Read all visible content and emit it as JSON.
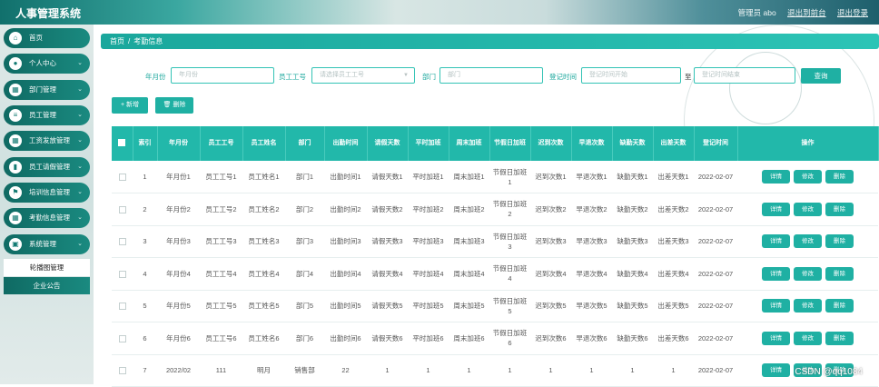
{
  "app": {
    "title": "人事管理系统"
  },
  "topbar": {
    "role_user": "管理员 abo",
    "back_link": "退出到前台",
    "logout_link": "退出登录"
  },
  "sidebar": {
    "items": [
      {
        "label": "首页",
        "icon": "home-icon",
        "glyph": "⌂",
        "has_chevron": false
      },
      {
        "label": "个人中心",
        "icon": "user-icon",
        "glyph": "●",
        "has_chevron": true
      },
      {
        "label": "部门管理",
        "icon": "grid-icon",
        "glyph": "▦",
        "has_chevron": true
      },
      {
        "label": "员工管理",
        "icon": "list-icon",
        "glyph": "≡",
        "has_chevron": true
      },
      {
        "label": "工资发放管理",
        "icon": "grid-icon",
        "glyph": "▦",
        "has_chevron": true
      },
      {
        "label": "员工请假管理",
        "icon": "chart-icon",
        "glyph": "▮",
        "has_chevron": true
      },
      {
        "label": "培训信息管理",
        "icon": "flag-icon",
        "glyph": "⚑",
        "has_chevron": true
      },
      {
        "label": "考勤信息管理",
        "icon": "grid-icon",
        "glyph": "▦",
        "has_chevron": true
      },
      {
        "label": "系统管理",
        "icon": "settings-icon",
        "glyph": "▣",
        "has_chevron": true,
        "expanded": true
      }
    ],
    "sub_items": [
      {
        "label": "轮播图管理",
        "active": true
      },
      {
        "label": "企业公告",
        "active": false
      }
    ]
  },
  "breadcrumb": {
    "home": "首页",
    "separator": "/",
    "current": "考勤信息"
  },
  "filters": {
    "month_label": "年月份",
    "month_placeholder": "年月份",
    "empno_label": "员工工号",
    "empno_placeholder": "请选择员工工号",
    "dept_label": "部门",
    "dept_placeholder": "部门",
    "regtime_label": "登记时间",
    "regtime_start_placeholder": "登记时间开始",
    "regtime_to": "至",
    "regtime_end_placeholder": "登记时间结束",
    "query_button": "查询"
  },
  "actions": {
    "add_button": "+ 新增",
    "delete_button": "删除"
  },
  "table": {
    "headers": [
      "",
      "索引",
      "年月份",
      "员工工号",
      "员工姓名",
      "部门",
      "出勤时间",
      "请假天数",
      "平时加班",
      "周末加班",
      "节假日加班",
      "迟到次数",
      "早退次数",
      "缺勤天数",
      "出差天数",
      "登记时间",
      "操作"
    ],
    "row_buttons": {
      "detail": "详情",
      "edit": "修改",
      "delete": "删除"
    },
    "rows": [
      [
        "1",
        "年月份1",
        "员工工号1",
        "员工姓名1",
        "部门1",
        "出勤时间1",
        "请假天数1",
        "平时加班1",
        "周末加班1",
        "节假日加班1",
        "迟到次数1",
        "早退次数1",
        "缺勤天数1",
        "出差天数1",
        "2022-02-07"
      ],
      [
        "2",
        "年月份2",
        "员工工号2",
        "员工姓名2",
        "部门2",
        "出勤时间2",
        "请假天数2",
        "平时加班2",
        "周末加班2",
        "节假日加班2",
        "迟到次数2",
        "早退次数2",
        "缺勤天数2",
        "出差天数2",
        "2022-02-07"
      ],
      [
        "3",
        "年月份3",
        "员工工号3",
        "员工姓名3",
        "部门3",
        "出勤时间3",
        "请假天数3",
        "平时加班3",
        "周末加班3",
        "节假日加班3",
        "迟到次数3",
        "早退次数3",
        "缺勤天数3",
        "出差天数3",
        "2022-02-07"
      ],
      [
        "4",
        "年月份4",
        "员工工号4",
        "员工姓名4",
        "部门4",
        "出勤时间4",
        "请假天数4",
        "平时加班4",
        "周末加班4",
        "节假日加班4",
        "迟到次数4",
        "早退次数4",
        "缺勤天数4",
        "出差天数4",
        "2022-02-07"
      ],
      [
        "5",
        "年月份5",
        "员工工号5",
        "员工姓名5",
        "部门5",
        "出勤时间5",
        "请假天数5",
        "平时加班5",
        "周末加班5",
        "节假日加班5",
        "迟到次数5",
        "早退次数5",
        "缺勤天数5",
        "出差天数5",
        "2022-02-07"
      ],
      [
        "6",
        "年月份6",
        "员工工号6",
        "员工姓名6",
        "部门6",
        "出勤时间6",
        "请假天数6",
        "平时加班6",
        "周末加班6",
        "节假日加班6",
        "迟到次数6",
        "早退次数6",
        "缺勤天数6",
        "出差天数6",
        "2022-02-07"
      ],
      [
        "7",
        "2022/02",
        "111",
        "明月",
        "销售部",
        "22",
        "1",
        "1",
        "1",
        "1",
        "1",
        "1",
        "1",
        "1",
        "2022-02-07"
      ]
    ]
  },
  "watermark": "CSDN @qq1084",
  "colors": {
    "accent": "#1fb0a3",
    "sidebar_item": "#137a72"
  }
}
